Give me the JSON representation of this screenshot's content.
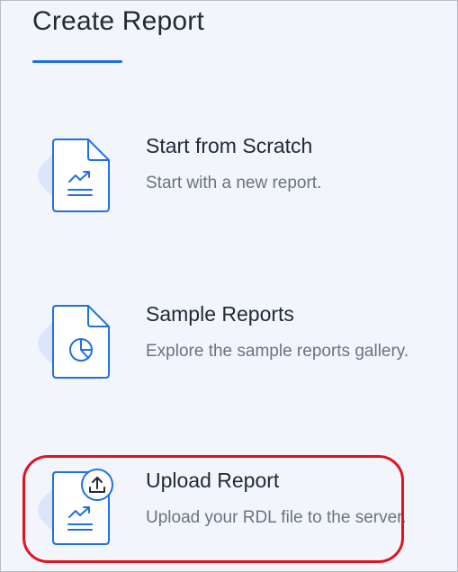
{
  "header": {
    "title": "Create Report"
  },
  "options": [
    {
      "title": "Start from Scratch",
      "description": "Start with a new report.",
      "icon": "new-report-icon"
    },
    {
      "title": "Sample Reports",
      "description": "Explore the sample reports gallery.",
      "icon": "sample-reports-icon"
    },
    {
      "title": "Upload Report",
      "description": "Upload your RDL file to the server.",
      "icon": "upload-report-icon"
    }
  ],
  "colors": {
    "accent": "#1f6fe8",
    "icon_blob": "#dbe6fb",
    "highlight": "#e0141e",
    "title_text": "#222a36",
    "desc_text": "#6b7280"
  }
}
